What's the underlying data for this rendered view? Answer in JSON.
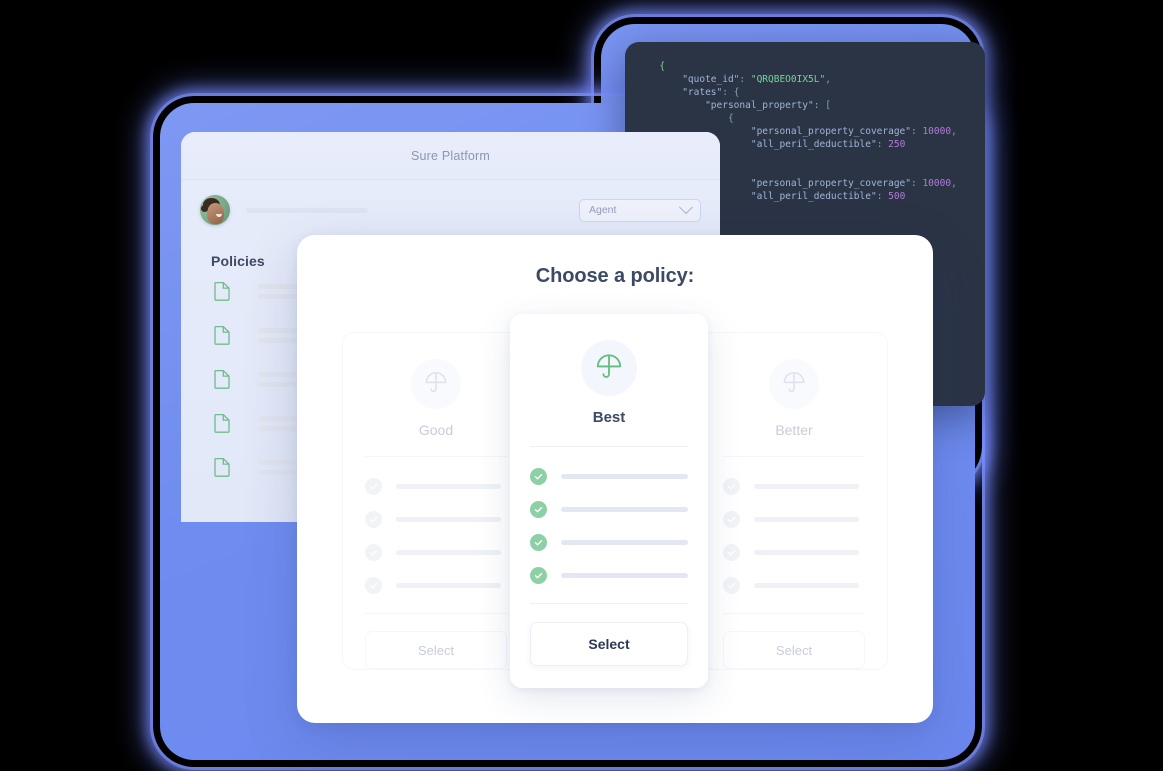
{
  "code_panel": {
    "name": "json-response",
    "lines": [
      {
        "indent": 1,
        "parts": [
          {
            "t": "{",
            "c": "b"
          }
        ]
      },
      {
        "indent": 2,
        "parts": [
          {
            "t": "\"quote_id\"",
            "c": "k"
          },
          {
            "t": ": ",
            "c": "p"
          },
          {
            "t": "\"QRQBEO0IX5L\"",
            "c": "s"
          },
          {
            "t": ",",
            "c": "p"
          }
        ]
      },
      {
        "indent": 2,
        "parts": [
          {
            "t": "\"rates\"",
            "c": "k"
          },
          {
            "t": ": {",
            "c": "p"
          }
        ]
      },
      {
        "indent": 3,
        "parts": [
          {
            "t": "\"personal_property\"",
            "c": "k"
          },
          {
            "t": ": [",
            "c": "p"
          }
        ]
      },
      {
        "indent": 4,
        "parts": [
          {
            "t": "{",
            "c": "p"
          }
        ]
      },
      {
        "indent": 5,
        "parts": [
          {
            "t": "\"personal_property_coverage\"",
            "c": "k"
          },
          {
            "t": ": ",
            "c": "p"
          },
          {
            "t": "10000",
            "c": "n"
          },
          {
            "t": ",",
            "c": "p"
          }
        ]
      },
      {
        "indent": 5,
        "parts": [
          {
            "t": "\"all_peril_deductible\"",
            "c": "k"
          },
          {
            "t": ": ",
            "c": "p"
          },
          {
            "t": "250",
            "c": "n"
          }
        ]
      },
      {
        "indent": 0,
        "parts": []
      },
      {
        "indent": 0,
        "parts": []
      },
      {
        "indent": 5,
        "parts": [
          {
            "t": "\"personal_property_coverage\"",
            "c": "k"
          },
          {
            "t": ": ",
            "c": "p"
          },
          {
            "t": "10000",
            "c": "n"
          },
          {
            "t": ",",
            "c": "p"
          }
        ]
      },
      {
        "indent": 5,
        "parts": [
          {
            "t": "\"all_peril_deductible\"",
            "c": "k"
          },
          {
            "t": ": ",
            "c": "p"
          },
          {
            "t": "500",
            "c": "n"
          }
        ]
      }
    ]
  },
  "platform": {
    "title": "Sure Platform",
    "user": {
      "avatar_alt": "user-avatar",
      "name_placeholder": ""
    },
    "role_select": {
      "value": "Agent",
      "icon": "chevron-down-icon"
    },
    "sidebar": {
      "heading": "Policies",
      "items": [
        {
          "icon": "document-icon",
          "label": ""
        },
        {
          "icon": "document-icon",
          "label": ""
        },
        {
          "icon": "document-icon",
          "label": ""
        },
        {
          "icon": "document-icon",
          "label": ""
        },
        {
          "icon": "document-icon",
          "label": ""
        }
      ]
    }
  },
  "modal": {
    "title": "Choose a policy:",
    "cards": [
      {
        "id": "good",
        "tier": "Good",
        "icon": "umbrella-icon",
        "featured": false,
        "features": 4,
        "select_label": "Select"
      },
      {
        "id": "best",
        "tier": "Best",
        "icon": "umbrella-icon",
        "featured": true,
        "features": 4,
        "select_label": "Select"
      },
      {
        "id": "better",
        "tier": "Better",
        "icon": "umbrella-icon",
        "featured": false,
        "features": 4,
        "select_label": "Select"
      }
    ]
  },
  "colors": {
    "blue_backdrop": "#6d8cf0",
    "code_panel_bg": "#2b3445",
    "accent_green": "#62bd7f",
    "check_green": "#8ed0a5",
    "text_dark": "#3d4a63",
    "text_muted": "#9aa4bb"
  }
}
